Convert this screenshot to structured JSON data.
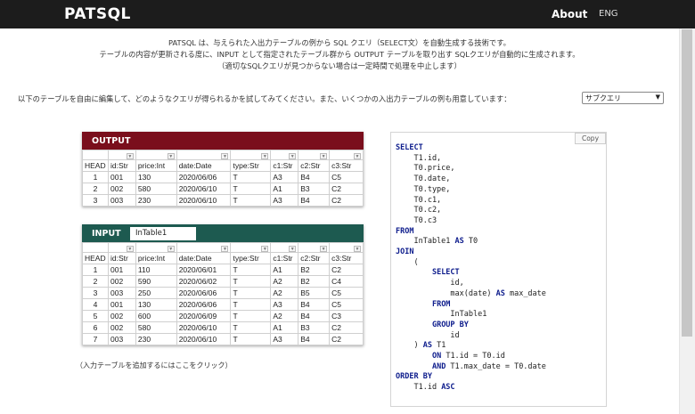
{
  "header": {
    "logo": "PATSQL",
    "nav": {
      "about": "About",
      "eng": "ENG"
    }
  },
  "intro": {
    "lines": [
      "PATSQL は、与えられた入出力テーブルの例から SQL クエリ（SELECT文）を自動生成する技術です。",
      "テーブルの内容が更新される度に、INPUT として指定されたテーブル群から OUTPUT テーブルを取り出す SQLクエリが自動的に生成されます。",
      "（適切なSQLクエリが見つからない場合は一定時間で処理を中止します）"
    ],
    "select_prompt": "以下のテーブルを自由に編集して、どのようなクエリが得られるかを試してみてください。また、いくつかの入出力テーブルの例も用意しています：",
    "sample_value": "サブクエリ"
  },
  "output_table": {
    "title": "OUTPUT",
    "columns": [
      "HEAD",
      "id:Str",
      "price:Int",
      "date:Date",
      "type:Str",
      "c1:Str",
      "c2:Str",
      "c3:Str"
    ],
    "rows": [
      [
        "1",
        "001",
        "130",
        "2020/06/06",
        "T",
        "A3",
        "B4",
        "C5"
      ],
      [
        "2",
        "002",
        "580",
        "2020/06/10",
        "T",
        "A1",
        "B3",
        "C2"
      ],
      [
        "3",
        "003",
        "230",
        "2020/06/10",
        "T",
        "A3",
        "B4",
        "C2"
      ]
    ]
  },
  "input_table": {
    "title": "INPUT",
    "name": "InTable1",
    "columns": [
      "HEAD",
      "id:Str",
      "price:Int",
      "date:Date",
      "type:Str",
      "c1:Str",
      "c2:Str",
      "c3:Str"
    ],
    "rows": [
      [
        "1",
        "001",
        "110",
        "2020/06/01",
        "T",
        "A1",
        "B2",
        "C2"
      ],
      [
        "2",
        "002",
        "590",
        "2020/06/02",
        "T",
        "A2",
        "B2",
        "C4"
      ],
      [
        "3",
        "003",
        "250",
        "2020/06/06",
        "T",
        "A2",
        "B5",
        "C5"
      ],
      [
        "4",
        "001",
        "130",
        "2020/06/06",
        "T",
        "A3",
        "B4",
        "C5"
      ],
      [
        "5",
        "002",
        "600",
        "2020/06/09",
        "T",
        "A2",
        "B4",
        "C3"
      ],
      [
        "6",
        "002",
        "580",
        "2020/06/10",
        "T",
        "A1",
        "B3",
        "C2"
      ],
      [
        "7",
        "003",
        "230",
        "2020/06/10",
        "T",
        "A3",
        "B4",
        "C2"
      ]
    ]
  },
  "add_table_link": "（入力テーブルを追加するにはここをクリック）",
  "sql": {
    "copy_label": "Copy",
    "lines": [
      [
        {
          "t": "SELECT",
          "k": true
        }
      ],
      [
        {
          "t": "    T1.id,"
        }
      ],
      [
        {
          "t": "    T0.price,"
        }
      ],
      [
        {
          "t": "    T0.date,"
        }
      ],
      [
        {
          "t": "    T0.type,"
        }
      ],
      [
        {
          "t": "    T0.c1,"
        }
      ],
      [
        {
          "t": "    T0.c2,"
        }
      ],
      [
        {
          "t": "    T0.c3"
        }
      ],
      [
        {
          "t": "FROM",
          "k": true
        }
      ],
      [
        {
          "t": "    InTable1 "
        },
        {
          "t": "AS",
          "k": true
        },
        {
          "t": " T0"
        }
      ],
      [
        {
          "t": "JOIN",
          "k": true
        }
      ],
      [
        {
          "t": "    ("
        }
      ],
      [
        {
          "t": "        "
        },
        {
          "t": "SELECT",
          "k": true
        }
      ],
      [
        {
          "t": "            id,"
        }
      ],
      [
        {
          "t": "            max(date) "
        },
        {
          "t": "AS",
          "k": true
        },
        {
          "t": " max_date"
        }
      ],
      [
        {
          "t": "        "
        },
        {
          "t": "FROM",
          "k": true
        }
      ],
      [
        {
          "t": "            InTable1"
        }
      ],
      [
        {
          "t": "        "
        },
        {
          "t": "GROUP BY",
          "k": true
        }
      ],
      [
        {
          "t": "            id"
        }
      ],
      [
        {
          "t": "    ) "
        },
        {
          "t": "AS",
          "k": true
        },
        {
          "t": " T1"
        }
      ],
      [
        {
          "t": "        "
        },
        {
          "t": "ON",
          "k": true
        },
        {
          "t": " T1.id = T0.id"
        }
      ],
      [
        {
          "t": "        "
        },
        {
          "t": "AND",
          "k": true
        },
        {
          "t": " T1.max_date = T0.date"
        }
      ],
      [
        {
          "t": "ORDER BY",
          "k": true
        }
      ],
      [
        {
          "t": "    T1.id "
        },
        {
          "t": "ASC",
          "k": true
        }
      ]
    ]
  }
}
